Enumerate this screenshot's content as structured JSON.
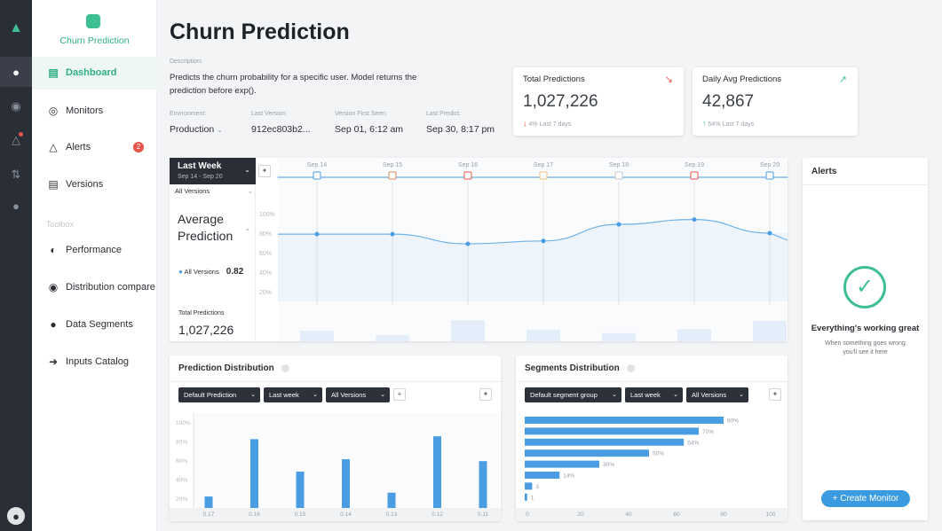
{
  "app": {
    "name": "Churn Prediction"
  },
  "sidebar": {
    "items": [
      {
        "label": "Dashboard"
      },
      {
        "label": "Monitors"
      },
      {
        "label": "Alerts",
        "badge": "2"
      },
      {
        "label": "Versions"
      }
    ],
    "toolbox_label": "Toolbox",
    "tools": [
      {
        "label": "Performance"
      },
      {
        "label": "Distribution compare"
      },
      {
        "label": "Data Segments"
      },
      {
        "label": "Inputs Catalog"
      }
    ]
  },
  "page": {
    "title": "Churn Prediction",
    "description_label": "Description:",
    "description": "Predicts the churn probability for a specific user. Model returns the prediction before exp().",
    "meta": [
      {
        "label": "Environment:",
        "value": "Production"
      },
      {
        "label": "Last Version:",
        "value": "912ec803b2..."
      },
      {
        "label": "Version First Seen:",
        "value": "Sep 01, 6:12 am"
      },
      {
        "label": "Last Predict:",
        "value": "Sep 30, 8:17 pm"
      }
    ]
  },
  "kpis": [
    {
      "title": "Total Predictions",
      "value": "1,027,226",
      "change": "4%",
      "period": "Last 7 days",
      "trend": "down",
      "color": "#e8534a"
    },
    {
      "title": "Daily Avg Predictions",
      "value": "42,867",
      "change": "54%",
      "period": "Last 7 days",
      "trend": "up",
      "color": "#3dbf93"
    }
  ],
  "timeline": {
    "period_label": "Last Week",
    "period_range": "Sep 14 - Sep 20",
    "version_filter": "All Versions",
    "metric": "Average Prediction",
    "legend_label": "All Versions",
    "legend_value": "0.82",
    "total_label": "Total Predictions",
    "total_value": "1,027,226",
    "markers": [
      "normal",
      "warn",
      "alert",
      "warn-light",
      "empty",
      "alert",
      "normal"
    ]
  },
  "alerts": {
    "title": "Alerts",
    "status": "Everything's working great",
    "note": "When something goes wrong you'll see it here",
    "button": "+ Create Monitor"
  },
  "prediction_distribution": {
    "title": "Prediction Distribution",
    "filters": [
      "Default Prediction",
      "Last week",
      "All Versions"
    ]
  },
  "segments_distribution": {
    "title": "Segments Distribution",
    "filters": [
      "Default segment group",
      "Last week",
      "All Versions"
    ]
  },
  "chart_data": [
    {
      "type": "line",
      "title": "Average Prediction",
      "x": [
        "Sep 14",
        "Sep 15",
        "Sep 16",
        "Sep 17",
        "Sep 18",
        "Sep 19",
        "Sep 20"
      ],
      "series": [
        {
          "name": "All Versions",
          "values": [
            0.79,
            0.79,
            0.69,
            0.72,
            0.89,
            0.94,
            0.8
          ]
        }
      ],
      "volume": [
        0.35,
        0.2,
        0.7,
        0.38,
        0.27,
        0.4,
        0.68
      ],
      "yticks": [
        "100%",
        "80%",
        "60%",
        "40%",
        "20%"
      ],
      "ylim": [
        0.1,
        1.1
      ]
    },
    {
      "type": "bar",
      "title": "Prediction Distribution",
      "categories": [
        "0.17",
        "0.16",
        "0.15",
        "0.14",
        "0.13",
        "0.12",
        "0.11"
      ],
      "values": [
        22,
        82,
        48,
        61,
        26,
        85,
        59
      ],
      "yticks": [
        "100%",
        "80%",
        "60%",
        "40%",
        "20%"
      ],
      "ylim": [
        10,
        100
      ]
    },
    {
      "type": "bar",
      "orientation": "horizontal",
      "title": "Segments Distribution",
      "values": [
        80,
        70,
        64,
        50,
        30,
        14,
        3,
        1
      ],
      "labels": [
        "80%",
        "70%",
        "64%",
        "50%",
        "30%",
        "14%",
        "3",
        "1"
      ],
      "xticks": [
        "0",
        "20",
        "40",
        "60",
        "80",
        "100"
      ],
      "xlim": [
        0,
        100
      ]
    }
  ]
}
